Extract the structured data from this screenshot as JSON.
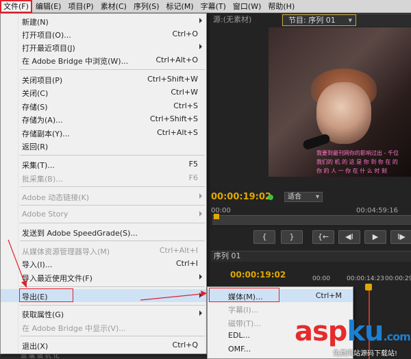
{
  "menubar": {
    "items": [
      "文件(F)",
      "编辑(E)",
      "项目(P)",
      "素材(C)",
      "序列(S)",
      "标记(M)",
      "字幕(T)",
      "窗口(W)",
      "帮助(H)"
    ]
  },
  "panels": {
    "source_tab": "源:(无素材)",
    "program_tab": "节目: 序列 01",
    "program_timecode": "00:00:19:02",
    "program_zoom": "适合",
    "program_duration": "00:04:59:16",
    "program_start": "00:00",
    "sequence_tab": "序列 01",
    "sequence_timecode": "00:00:19:02",
    "ruler": [
      "00:00",
      "00:00:14:23",
      "00:00:29"
    ],
    "transport": [
      "{",
      "}",
      "{←",
      "◀I",
      "▶",
      "I▶"
    ],
    "video_subtitles": [
      "我要到最刊网你的影响过出 - 千位",
      "我们的 机 的 这 是 你 到 你 在 的",
      "你 的 人 一 你 在 什 么 时 刻"
    ],
    "bottom_status": "镜 编 辑 机 化"
  },
  "file_menu": {
    "items": [
      {
        "label": "新建(N)",
        "shortcut": "",
        "submenu": true,
        "disabled": false
      },
      {
        "label": "打开项目(O)...",
        "shortcut": "Ctrl+O",
        "submenu": false,
        "disabled": false
      },
      {
        "label": "打开最近项目(J)",
        "shortcut": "",
        "submenu": true,
        "disabled": false
      },
      {
        "label": "在 Adobe Bridge 中浏览(W)...",
        "shortcut": "Ctrl+Alt+O",
        "submenu": false,
        "disabled": false
      },
      {
        "label": "关闭项目(P)",
        "shortcut": "Ctrl+Shift+W",
        "submenu": false,
        "disabled": false
      },
      {
        "label": "关闭(C)",
        "shortcut": "Ctrl+W",
        "submenu": false,
        "disabled": false
      },
      {
        "label": "存储(S)",
        "shortcut": "Ctrl+S",
        "submenu": false,
        "disabled": false
      },
      {
        "label": "存储为(A)...",
        "shortcut": "Ctrl+Shift+S",
        "submenu": false,
        "disabled": false
      },
      {
        "label": "存储副本(Y)...",
        "shortcut": "Ctrl+Alt+S",
        "submenu": false,
        "disabled": false
      },
      {
        "label": "返回(R)",
        "shortcut": "",
        "submenu": false,
        "disabled": false
      },
      {
        "label": "采集(T)...",
        "shortcut": "F5",
        "submenu": false,
        "disabled": false
      },
      {
        "label": "批采集(B)...",
        "shortcut": "F6",
        "submenu": false,
        "disabled": true
      },
      {
        "label": "Adobe 动态链接(K)",
        "shortcut": "",
        "submenu": true,
        "disabled": true
      },
      {
        "label": "Adobe Story",
        "shortcut": "",
        "submenu": true,
        "disabled": true
      },
      {
        "label": "发送到 Adobe SpeedGrade(S)...",
        "shortcut": "",
        "submenu": false,
        "disabled": false
      },
      {
        "label": "从媒体资源管理器导入(M)",
        "shortcut": "Ctrl+Alt+I",
        "submenu": false,
        "disabled": true
      },
      {
        "label": "导入(I)...",
        "shortcut": "Ctrl+I",
        "submenu": false,
        "disabled": false
      },
      {
        "label": "导入最近使用文件(F)",
        "shortcut": "",
        "submenu": true,
        "disabled": false
      },
      {
        "label": "导出(E)",
        "shortcut": "",
        "submenu": true,
        "disabled": false
      },
      {
        "label": "获取属性(G)",
        "shortcut": "",
        "submenu": true,
        "disabled": false
      },
      {
        "label": "在 Adobe Bridge 中显示(V)...",
        "shortcut": "",
        "submenu": false,
        "disabled": true
      },
      {
        "label": "退出(X)",
        "shortcut": "Ctrl+Q",
        "submenu": false,
        "disabled": false
      }
    ]
  },
  "export_submenu": {
    "items": [
      {
        "label": "媒体(M)...",
        "shortcut": "Ctrl+M",
        "disabled": false
      },
      {
        "label": "字幕(I)...",
        "shortcut": "",
        "disabled": true
      },
      {
        "label": "磁带(T)...",
        "shortcut": "",
        "disabled": true
      },
      {
        "label": "EDL...",
        "shortcut": "",
        "disabled": false
      },
      {
        "label": "OMF...",
        "shortcut": "",
        "disabled": false
      }
    ]
  },
  "watermark": {
    "logo_a": "asp",
    "logo_b": "ku",
    "logo_c": ".com",
    "tagline": "免费网站源码下载站!"
  },
  "colors": {
    "annotation_red": "#e0202a",
    "timecode_yellow": "#e0a800",
    "menu_bg": "#f0f0f0",
    "menu_highlight": "#cfe1f5"
  }
}
